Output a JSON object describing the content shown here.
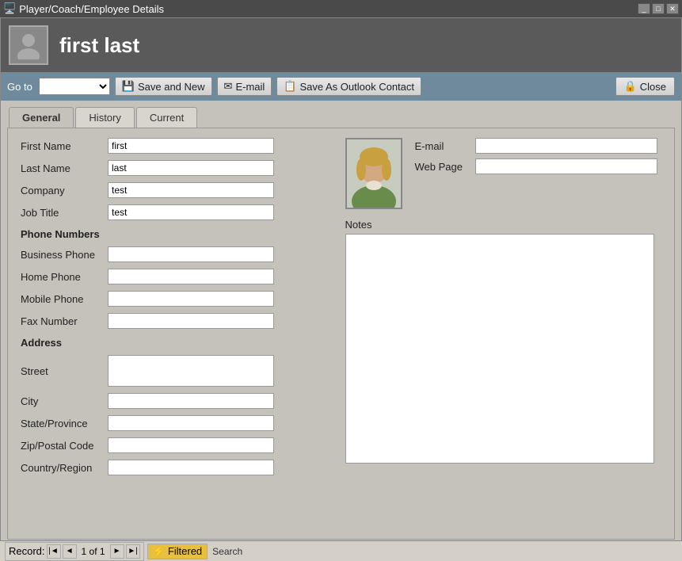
{
  "titleBar": {
    "title": "Player/Coach/Employee Details",
    "controls": [
      "minimize",
      "restore",
      "close"
    ]
  },
  "header": {
    "name": "first last"
  },
  "toolbar": {
    "goto_label": "Go to",
    "goto_value": "",
    "save_new_label": "Save and New",
    "email_label": "E-mail",
    "save_outlook_label": "Save As Outlook Contact",
    "close_label": "Close"
  },
  "tabs": [
    {
      "id": "general",
      "label": "General",
      "active": true
    },
    {
      "id": "history",
      "label": "History",
      "active": false
    },
    {
      "id": "current",
      "label": "Current",
      "active": false
    }
  ],
  "form": {
    "first_name_label": "First Name",
    "first_name_value": "first",
    "last_name_label": "Last Name",
    "last_name_value": "last",
    "company_label": "Company",
    "company_value": "test",
    "job_title_label": "Job Title",
    "job_title_value": "test",
    "email_label": "E-mail",
    "email_value": "",
    "web_page_label": "Web Page",
    "web_page_value": "",
    "phone_section": "Phone Numbers",
    "business_phone_label": "Business Phone",
    "business_phone_value": "",
    "home_phone_label": "Home Phone",
    "home_phone_value": "",
    "mobile_phone_label": "Mobile Phone",
    "mobile_phone_value": "",
    "fax_number_label": "Fax Number",
    "fax_number_value": "",
    "address_section": "Address",
    "street_label": "Street",
    "street_value": "",
    "city_label": "City",
    "city_value": "",
    "state_label": "State/Province",
    "state_value": "",
    "zip_label": "Zip/Postal Code",
    "zip_value": "",
    "country_label": "Country/Region",
    "country_value": "",
    "notes_label": "Notes"
  },
  "statusBar": {
    "record_label": "Record:",
    "record_first": "◄",
    "record_prev": "◄",
    "record_info": "1 of 1",
    "record_next": "►",
    "record_last": "►",
    "filtered_label": "Filtered",
    "search_label": "Search"
  }
}
